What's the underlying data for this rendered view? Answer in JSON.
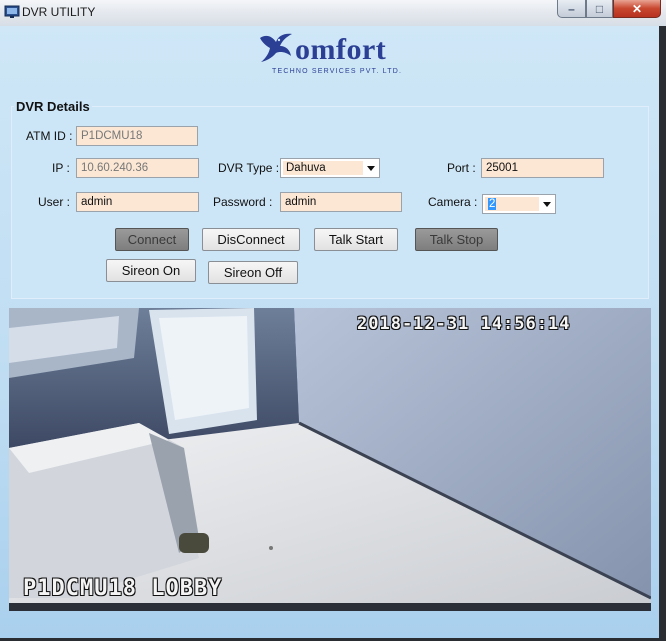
{
  "window": {
    "title": "DVR UTILITY",
    "buttons": {
      "minimize": "–",
      "maximize": "□",
      "close": "✕"
    }
  },
  "logo": {
    "word": "omfort",
    "tagline": "TECHNO SERVICES PVT. LTD."
  },
  "group": {
    "legend": "DVR Details"
  },
  "form": {
    "atm_id": {
      "label": "ATM ID :",
      "value": "P1DCMU18"
    },
    "ip": {
      "label": "IP :",
      "value": "10.60.240.36"
    },
    "dvr_type": {
      "label": "DVR Type :",
      "value": "Dahuva"
    },
    "port": {
      "label": "Port :",
      "value": "25001"
    },
    "user": {
      "label": "User :",
      "value": "admin"
    },
    "password": {
      "label": "Password :",
      "value": "admin"
    },
    "camera": {
      "label": "Camera :",
      "value": "2"
    }
  },
  "buttons": {
    "connect": "Connect",
    "disconnect": "DisConnect",
    "talk_start": "Talk Start",
    "talk_stop": "Talk Stop",
    "sireon_on": "Sireon On",
    "sireon_off": "Sireon Off"
  },
  "camera_view": {
    "timestamp": "2018-12-31  14:56:14",
    "caption": "P1DCMU18 LOBBY"
  },
  "colors": {
    "field_bg": "#fbe7d4",
    "logo_blue": "#2b3f94",
    "client_bg": "#bedcf2"
  }
}
